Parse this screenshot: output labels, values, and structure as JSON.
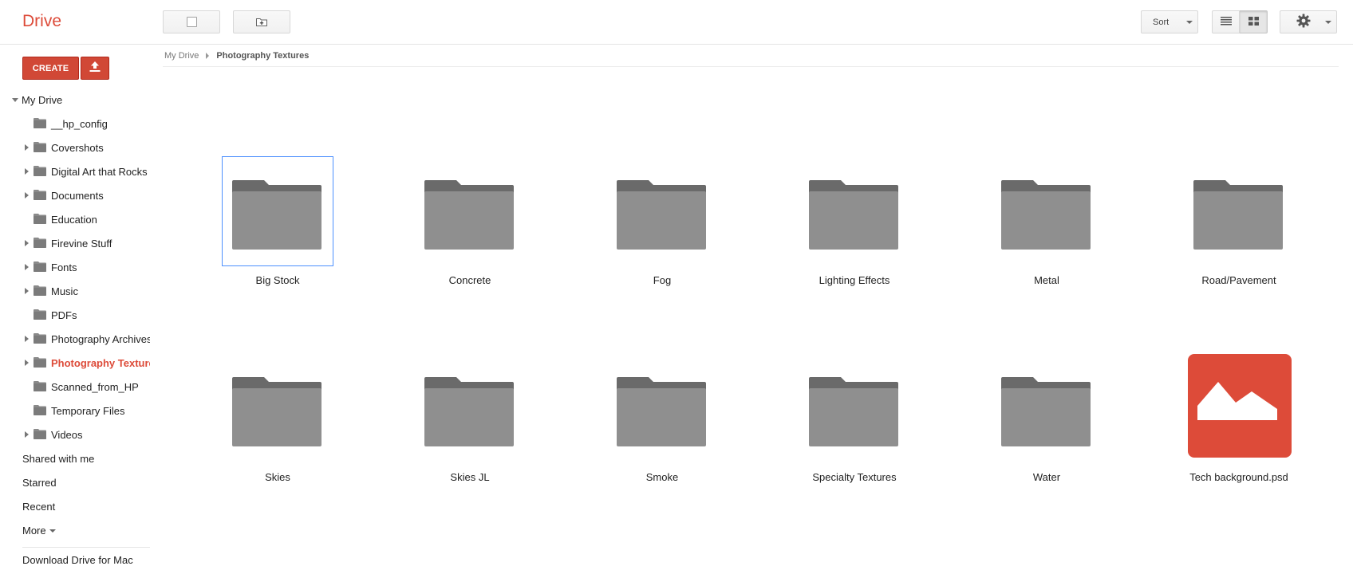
{
  "app": {
    "title": "Drive"
  },
  "toolbar": {
    "sort_label": "Sort"
  },
  "sidebar": {
    "create_label": "CREATE",
    "root_label": "My Drive",
    "folders": [
      {
        "label": "__hp_config",
        "expandable": false,
        "selected": false
      },
      {
        "label": "Covershots",
        "expandable": true,
        "selected": false
      },
      {
        "label": "Digital Art that Rocks",
        "expandable": true,
        "selected": false
      },
      {
        "label": "Documents",
        "expandable": true,
        "selected": false
      },
      {
        "label": "Education",
        "expandable": false,
        "selected": false
      },
      {
        "label": "Firevine Stuff",
        "expandable": true,
        "selected": false
      },
      {
        "label": "Fonts",
        "expandable": true,
        "selected": false
      },
      {
        "label": "Music",
        "expandable": true,
        "selected": false
      },
      {
        "label": "PDFs",
        "expandable": false,
        "selected": false
      },
      {
        "label": "Photography Archives",
        "expandable": true,
        "selected": false
      },
      {
        "label": "Photography Textures",
        "expandable": true,
        "selected": true
      },
      {
        "label": "Scanned_from_HP",
        "expandable": false,
        "selected": false
      },
      {
        "label": "Temporary Files",
        "expandable": false,
        "selected": false
      },
      {
        "label": "Videos",
        "expandable": true,
        "selected": false
      }
    ],
    "nav": [
      "Shared with me",
      "Starred",
      "Recent"
    ],
    "more_label": "More",
    "download_label": "Download Drive for Mac"
  },
  "breadcrumb": {
    "root": "My Drive",
    "current": "Photography Textures"
  },
  "items": [
    {
      "name": "Big Stock",
      "type": "folder",
      "focused": true
    },
    {
      "name": "Concrete",
      "type": "folder",
      "focused": false
    },
    {
      "name": "Fog",
      "type": "folder",
      "focused": false
    },
    {
      "name": "Lighting Effects",
      "type": "folder",
      "focused": false
    },
    {
      "name": "Metal",
      "type": "folder",
      "focused": false
    },
    {
      "name": "Road/Pavement",
      "type": "folder",
      "focused": false
    },
    {
      "name": "Skies",
      "type": "folder",
      "focused": false
    },
    {
      "name": "Skies JL",
      "type": "folder",
      "focused": false
    },
    {
      "name": "Smoke",
      "type": "folder",
      "focused": false
    },
    {
      "name": "Specialty Textures",
      "type": "folder",
      "focused": false
    },
    {
      "name": "Water",
      "type": "folder",
      "focused": false
    },
    {
      "name": "Tech background.psd",
      "type": "image",
      "focused": false
    }
  ],
  "colors": {
    "brand_red": "#dd4b39",
    "create_red": "#d14836",
    "folder_gray": "#8f8f8f",
    "folder_tab": "#6a6a6a",
    "focus_blue": "#4d90fe"
  }
}
